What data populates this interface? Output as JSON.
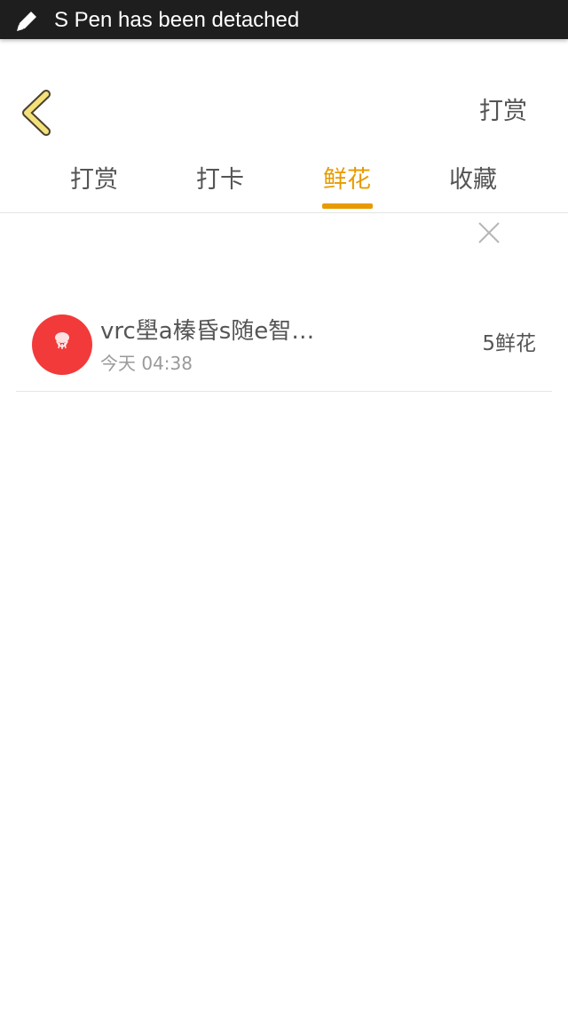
{
  "status_bar": {
    "message": "S Pen has been detached",
    "icon": "pen-icon"
  },
  "header": {
    "back_icon": "chevron-left-icon",
    "action_label": "打赏",
    "accent_color": "#e89b00"
  },
  "tabs": [
    {
      "label": "打赏",
      "active": false
    },
    {
      "label": "打卡",
      "active": false
    },
    {
      "label": "鲜花",
      "active": true
    },
    {
      "label": "收藏",
      "active": false
    }
  ],
  "close_icon": "close-icon",
  "list": {
    "items": [
      {
        "name": "vrc壆a榛昏s随e智…",
        "time": "今天 04:38",
        "amount": "5鲜花",
        "avatar_color": "#f23a3a"
      }
    ]
  }
}
